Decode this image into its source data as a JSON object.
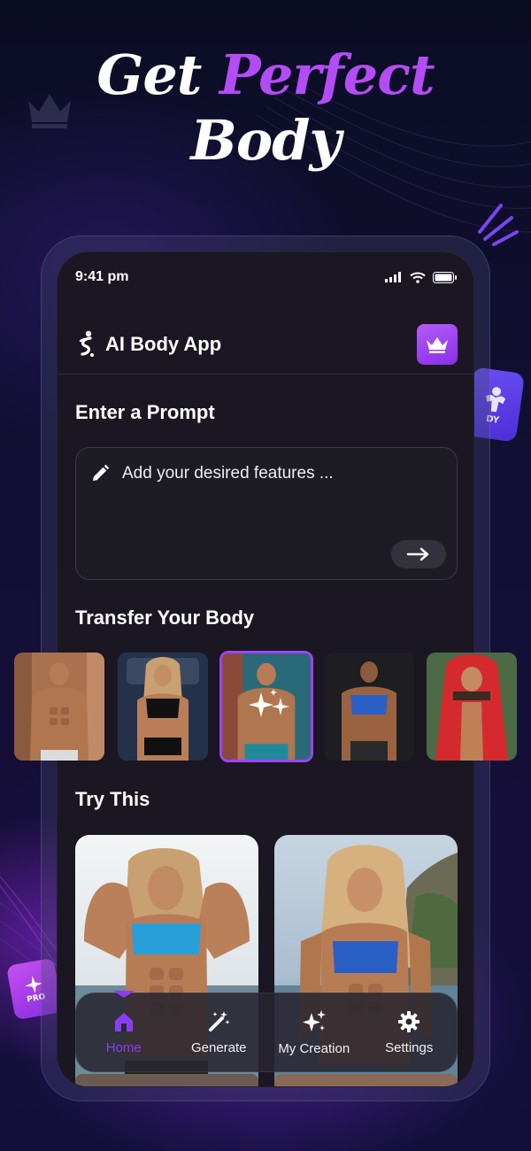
{
  "headline": {
    "line1_plain": "Get",
    "line1_accent": "Perfect",
    "line2": "Body"
  },
  "colors": {
    "accent": "#b44cf6",
    "active_nav": "#8a3df0",
    "screen_bg": "#1a1622",
    "premium_gradient_start": "#b35cf7"
  },
  "decor": {
    "right_badge_text": "DY",
    "left_badge_text": "PRO"
  },
  "status_bar": {
    "time": "9:41 pm",
    "icons": [
      "signal-icon",
      "wifi-icon",
      "battery-icon"
    ]
  },
  "app": {
    "title": "AI Body App",
    "logo_icon": "figure-logo-icon",
    "premium_icon": "crown-icon"
  },
  "prompt": {
    "title": "Enter a Prompt",
    "placeholder": "Add your desired features ...",
    "edit_icon": "pencil-icon",
    "submit_icon": "arrow-right-icon"
  },
  "transfer": {
    "title": "Transfer Your Body",
    "items": [
      {
        "label": "male-shirtless-street",
        "selected": false
      },
      {
        "label": "female-black-sportswear",
        "selected": false
      },
      {
        "label": "male-teal-shorts",
        "selected": true
      },
      {
        "label": "female-blue-sports-bra",
        "selected": false
      },
      {
        "label": "male-red-hoodie",
        "selected": false
      }
    ]
  },
  "try_this": {
    "title": "Try This",
    "items": [
      "female-flexing-beach",
      "female-blue-top-coast"
    ]
  },
  "nav": {
    "items": [
      {
        "label": "Home",
        "icon": "home-icon",
        "active": true
      },
      {
        "label": "Generate",
        "icon": "magic-wand-icon",
        "active": false
      },
      {
        "label": "My Creation",
        "icon": "sparkles-icon",
        "active": false
      },
      {
        "label": "Settings",
        "icon": "gear-icon",
        "active": false
      }
    ]
  }
}
